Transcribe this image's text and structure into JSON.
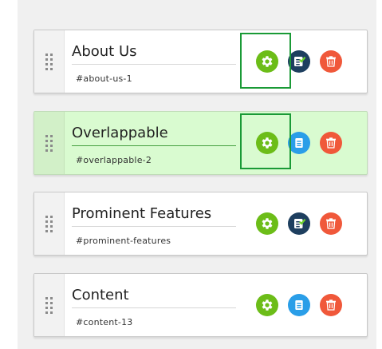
{
  "sections": [
    {
      "title": "About Us",
      "anchor": "#about-us-1",
      "highlighted": false,
      "focused": true,
      "content_icon": "checklist-icon"
    },
    {
      "title": "Overlappable",
      "anchor": "#overlappable-2",
      "highlighted": true,
      "focused": true,
      "content_icon": "document-icon"
    },
    {
      "title": "Prominent Features",
      "anchor": "#prominent-features",
      "highlighted": false,
      "focused": false,
      "content_icon": "checklist-icon"
    },
    {
      "title": "Content",
      "anchor": "#content-13",
      "highlighted": false,
      "focused": false,
      "content_icon": "document-icon"
    }
  ],
  "icons": {
    "drag": "drag-handle-icon",
    "settings": "gear-icon",
    "delete": "trash-icon"
  },
  "colors": {
    "settings_button": "#6cbd18",
    "content_button_dark": "#1e3f5f",
    "content_button_blue": "#2a9ee8",
    "delete_button": "#f0583a",
    "highlight_background": "#d9fbd0",
    "focus_outline": "#1a9a36"
  }
}
